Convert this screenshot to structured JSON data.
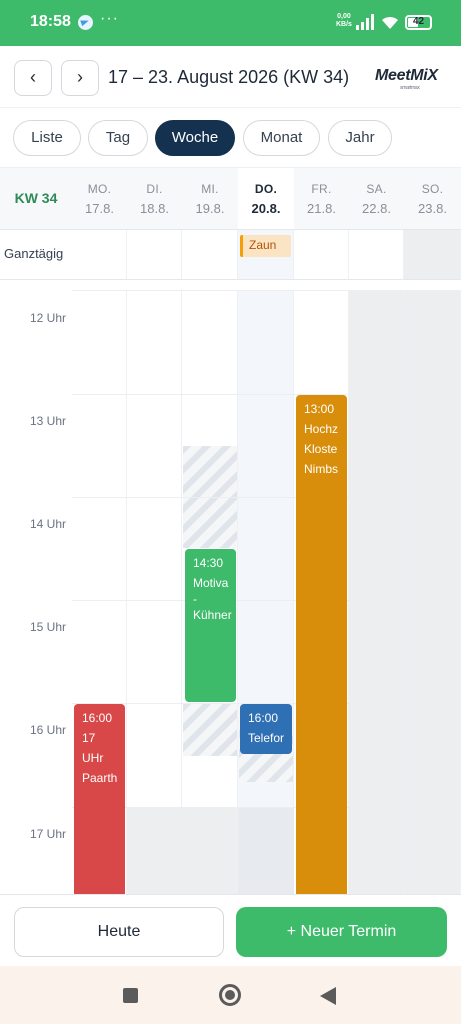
{
  "status_bar": {
    "time": "18:58",
    "dots": "···",
    "speed_value": "0,00",
    "speed_unit": "KB/s",
    "battery": "42"
  },
  "header": {
    "prev_label": "‹",
    "next_label": "›",
    "title": "17 – 23. August 2026 (KW 34)",
    "logo": "MeetMiX",
    "logo_sub": "smartmax"
  },
  "tabs": [
    {
      "label": "Liste",
      "active": false
    },
    {
      "label": "Tag",
      "active": false
    },
    {
      "label": "Woche",
      "active": true
    },
    {
      "label": "Monat",
      "active": false
    },
    {
      "label": "Jahr",
      "active": false
    }
  ],
  "calendar": {
    "week_label": "KW 34",
    "allday_label": "Ganztägig",
    "days": [
      {
        "weekday": "MO.",
        "date": "17.8."
      },
      {
        "weekday": "DI.",
        "date": "18.8."
      },
      {
        "weekday": "MI.",
        "date": "19.8."
      },
      {
        "weekday": "DO.",
        "date": "20.8.",
        "today": true
      },
      {
        "weekday": "FR.",
        "date": "21.8."
      },
      {
        "weekday": "SA.",
        "date": "22.8."
      },
      {
        "weekday": "SO.",
        "date": "23.8."
      }
    ],
    "hours": [
      "12 Uhr",
      "13 Uhr",
      "14 Uhr",
      "15 Uhr",
      "16 Uhr",
      "17 Uhr"
    ],
    "allday_events": [
      {
        "day": 3,
        "title": "Zaun",
        "color": "#f59e0b"
      }
    ],
    "events": [
      {
        "day": 0,
        "lines": [
          "16:00",
          "17",
          "UHr",
          "Paarth"
        ],
        "start": "16:00",
        "color": "#d94848"
      },
      {
        "day": 2,
        "lines": [
          "14:30",
          "Motiva",
          "-",
          "Kühner"
        ],
        "start": "14:30",
        "end": "15:30",
        "color": "#3dbb6a"
      },
      {
        "day": 3,
        "lines": [
          "16:00",
          "Telefor"
        ],
        "start": "16:00",
        "end": "16:30",
        "color": "#2f6fb3"
      },
      {
        "day": 4,
        "lines": [
          "13:00",
          "Hochz",
          "Kloste",
          "Nimbs"
        ],
        "start": "13:00",
        "color": "#d88e0b"
      }
    ]
  },
  "actions": {
    "today": "Heute",
    "new_event": "+ Neuer Termin"
  }
}
